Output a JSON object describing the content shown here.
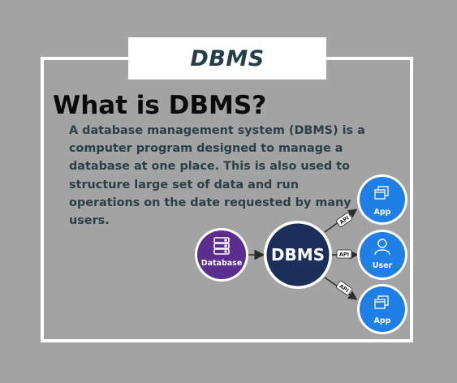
{
  "banner": {
    "title": "DBMS"
  },
  "heading": "What is DBMS?",
  "description": "A database management system (DBMS) is a computer program designed to manage a database at one place. This is also used to structure large set of data and run operations on the date requested by many users.",
  "diagram": {
    "database_label": "Database",
    "dbms_label": "DBMS",
    "clients": [
      {
        "label": "App",
        "icon": "app-windows-icon"
      },
      {
        "label": "User",
        "icon": "user-icon"
      },
      {
        "label": "App",
        "icon": "app-windows-icon"
      }
    ],
    "connector_labels": [
      "API",
      "API",
      "API"
    ],
    "colors": {
      "database": "#5b2d8e",
      "dbms": "#1c2f5a",
      "client": "#1f7fe6",
      "ring": "#ffffff"
    }
  }
}
